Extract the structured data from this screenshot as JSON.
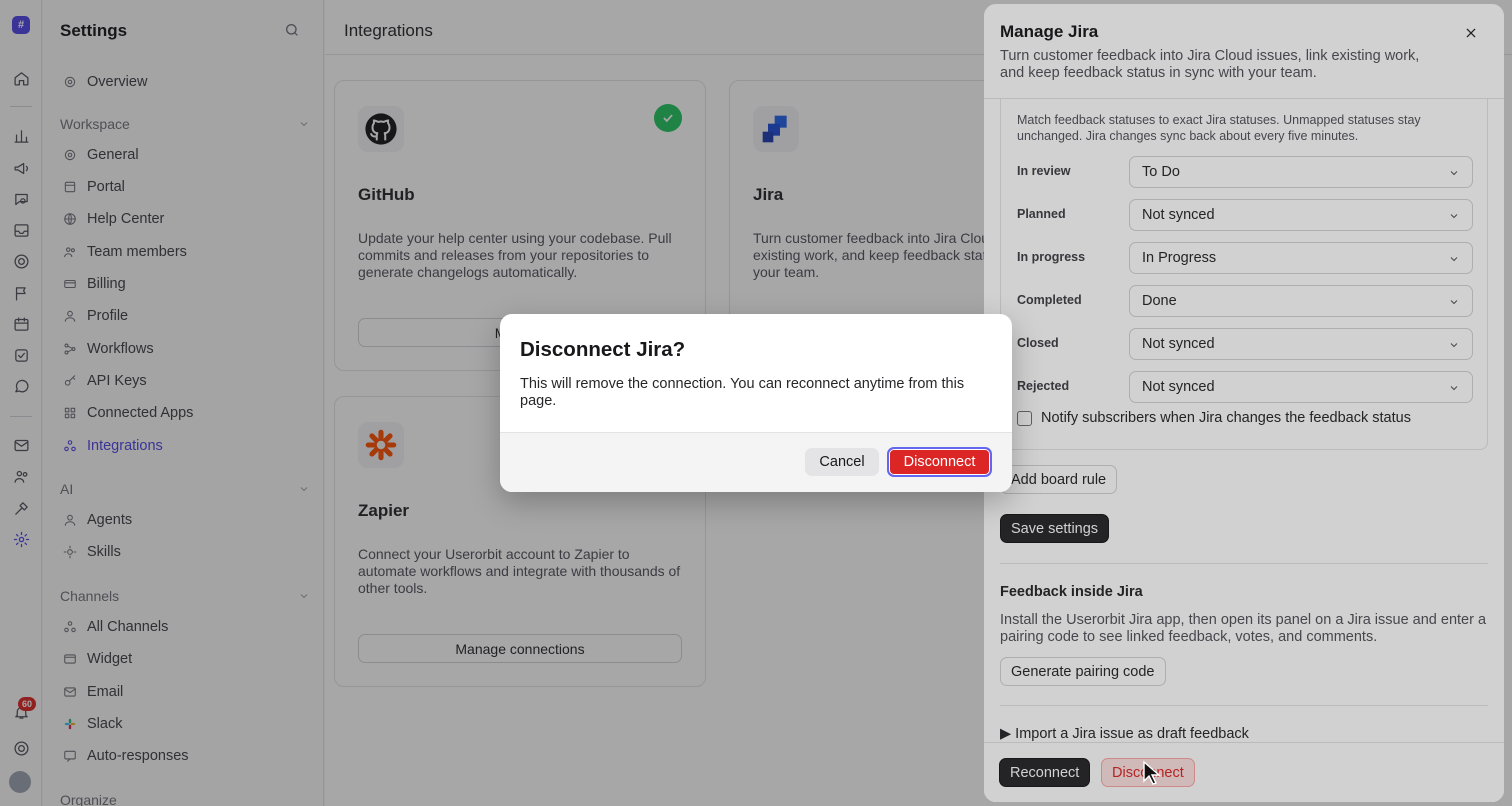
{
  "rail": {
    "logo_glyph": "#",
    "notification_count": "60",
    "active_color": "#4f46e5"
  },
  "sidebar": {
    "title": "Settings",
    "overview": "Overview",
    "workspace_header": "Workspace",
    "workspace_items": [
      "General",
      "Portal",
      "Help Center",
      "Team members",
      "Billing",
      "Profile",
      "Workflows",
      "API Keys",
      "Connected Apps",
      "Integrations"
    ],
    "ai_header": "AI",
    "ai_items": [
      "Agents",
      "Skills"
    ],
    "channels_header": "Channels",
    "channel_items": [
      "All Channels",
      "Widget",
      "Email",
      "Slack",
      "Auto-responses"
    ],
    "cut_off_header": "Organize"
  },
  "main": {
    "title": "Integrations",
    "cards": [
      {
        "name": "GitHub",
        "description": "Update your help center using your codebase. Pull commits and releases from your repositories to generate changelogs automatically.",
        "button": "Manage",
        "connected": true
      },
      {
        "name": "Jira",
        "description": "Turn customer feedback into Jira Cloud issues, link existing work, and keep feedback status in sync with your team.",
        "button": ""
      },
      {
        "name": "Zapier",
        "description": "Connect your Userorbit account to Zapier to automate workflows and integrate with thousands of other tools.",
        "button": "Manage connections"
      }
    ]
  },
  "panel": {
    "title": "Manage Jira",
    "subtitle": "Turn customer feedback into Jira Cloud issues, link existing work, and keep feedback status in sync with your team.",
    "status_note": "Match feedback statuses to exact Jira statuses. Unmapped statuses stay unchanged. Jira changes sync back about every five minutes.",
    "mappings": [
      {
        "label": "In review",
        "value": "To Do"
      },
      {
        "label": "Planned",
        "value": "Not synced"
      },
      {
        "label": "In progress",
        "value": "In Progress"
      },
      {
        "label": "Completed",
        "value": "Done"
      },
      {
        "label": "Closed",
        "value": "Not synced"
      },
      {
        "label": "Rejected",
        "value": "Not synced"
      }
    ],
    "notify_label": "Notify subscribers when Jira changes the feedback status",
    "notify_checked": false,
    "add_board_rule": "Add board rule",
    "save_settings": "Save settings",
    "feedback_heading": "Feedback inside Jira",
    "feedback_text": "Install the Userorbit Jira app, then open its panel on a Jira issue and enter a pairing code to see linked feedback, votes, and comments.",
    "pairing_button": "Generate pairing code",
    "import_label": "▶ Import a Jira issue as draft feedback",
    "reconnect": "Reconnect",
    "disconnect": "Disconnect"
  },
  "modal": {
    "title": "Disconnect Jira?",
    "body": "This will remove the connection. You can reconnect anytime from this page.",
    "cancel": "Cancel",
    "confirm": "Disconnect",
    "confirm_color": "#dc2626"
  }
}
